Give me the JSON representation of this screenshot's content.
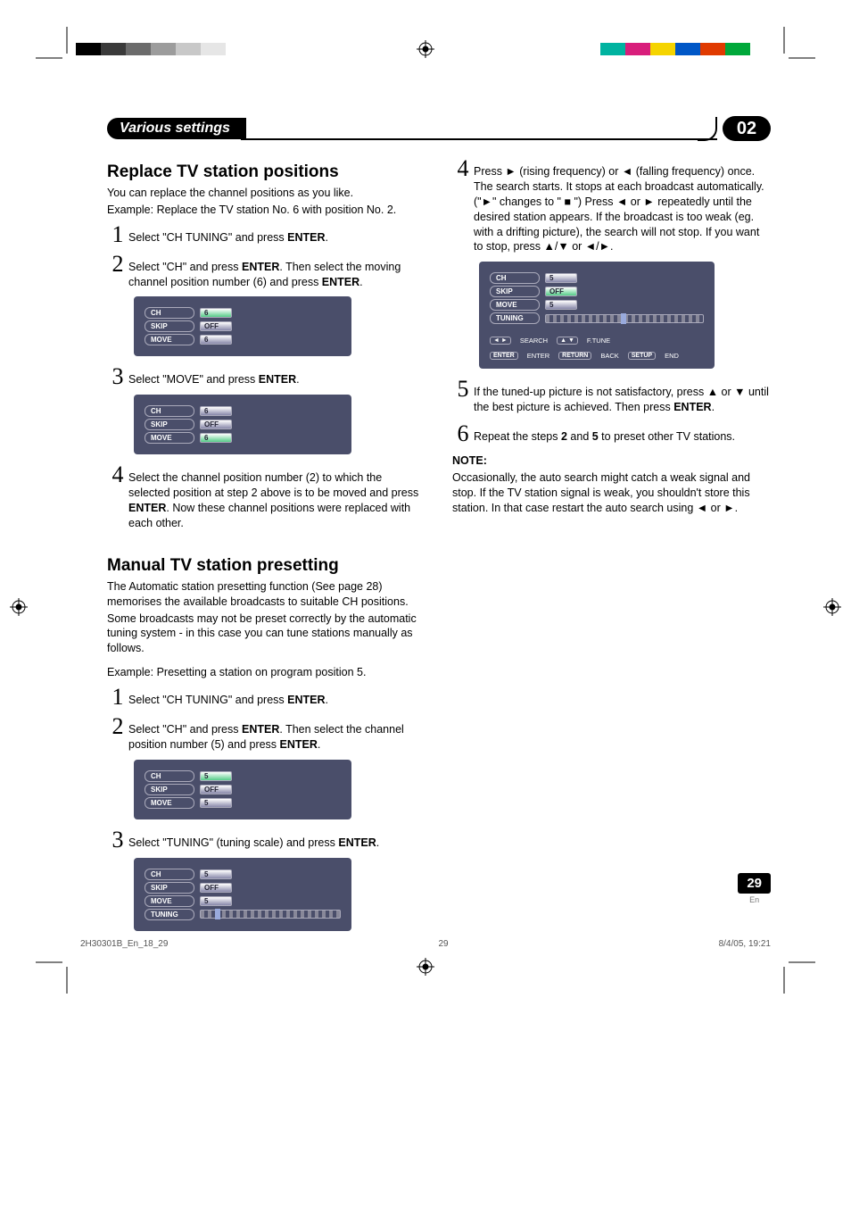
{
  "header": {
    "chapter_title": "Various settings",
    "chapter_number": "02"
  },
  "section1": {
    "title": "Replace TV station positions",
    "intro": "You can replace the channel positions as you like.",
    "example_label": "Example:",
    "example_text": "Replace the TV station No. 6 with position No. 2.",
    "steps": [
      {
        "n": "1",
        "text": "Select \"CH TUNING\" and press ",
        "bold_tail": "ENTER",
        "tail": "."
      },
      {
        "n": "2",
        "text": "Select \"CH\" and press ",
        "bold_tail": "ENTER",
        "tail": ". Then select the moving channel position number (6) and press ",
        "bold_tail2": "ENTER",
        "tail2": "."
      },
      {
        "n": "3",
        "text": "Select \"MOVE\" and press ",
        "bold_tail": "ENTER",
        "tail": "."
      },
      {
        "n": "4",
        "text": "Select the channel position number (2) to which the selected position at step 2 above is to be moved and press ",
        "bold_tail": "ENTER",
        "tail": ". Now these channel positions were replaced with each other."
      }
    ],
    "osd1": {
      "ch": "6",
      "skip": "OFF",
      "move": "6"
    },
    "osd2": {
      "ch": "6",
      "skip": "OFF",
      "move": "6"
    }
  },
  "section2": {
    "title": "Manual TV station presetting",
    "p1": "The Automatic station presetting function (See page 28) memorises the available broadcasts to suitable CH positions.",
    "p2": "Some broadcasts may not be preset correctly by the automatic tuning system - in this case you can tune stations manually as follows.",
    "example": "Example: Presetting a station on program position 5.",
    "steps_left": [
      {
        "n": "1",
        "text": "Select \"CH TUNING\" and press ",
        "bold_tail": "ENTER",
        "tail": "."
      },
      {
        "n": "2",
        "text": "Select \"CH\" and press ",
        "bold_tail": "ENTER",
        "tail": ". Then select the channel position number (5) and press ",
        "bold_tail2": "ENTER",
        "tail2": "."
      },
      {
        "n": "3",
        "text": "Select \"TUNING\" (tuning scale) and press ",
        "bold_tail": "ENTER",
        "tail": "."
      }
    ],
    "osd3": {
      "ch": "5",
      "skip": "OFF",
      "move": "5"
    },
    "osd4": {
      "ch": "5",
      "skip": "OFF",
      "move": "5",
      "tuning": true
    },
    "steps_right": [
      {
        "n": "4",
        "text": "Press ► (rising frequency) or ◄ (falling frequency) once. The search starts. It stops at each broadcast automatically. (\"►\" changes to \" ■ \") Press ◄ or ► repeatedly until the desired station appears.   If the broadcast is too weak (eg. with a drifting picture), the search will not stop. If you want to stop, press ▲/▼ or ◄/►."
      },
      {
        "n": "5",
        "text": "If the tuned-up picture is not satisfactory, press ▲ or ▼ until the best picture is achieved. Then press ",
        "bold_tail": "ENTER",
        "tail": "."
      },
      {
        "n": "6",
        "pre": "Repeat the steps ",
        "bold1": "2",
        "mid": " and ",
        "bold2": "5",
        "post": " to preset other TV stations."
      }
    ],
    "osd5": {
      "ch": "5",
      "skip": "OFF",
      "move": "5",
      "tuning": true,
      "legend": {
        "lr": "◄ ►",
        "search": "SEARCH",
        "ud": "▲ ▼",
        "ftune": "F.TUNE",
        "enter_k": "ENTER",
        "enter_t": "ENTER",
        "return_k": "RETURN",
        "back": "BACK",
        "setup": "SETUP",
        "end": "END"
      }
    },
    "note_title": "NOTE:",
    "note_body": "Occasionally, the auto search might catch a weak signal and stop. If the TV station signal is weak, you shouldn't store this station. In that case restart the auto search using ◄ or ►."
  },
  "osd_labels": {
    "ch": "CH",
    "skip": "SKIP",
    "move": "MOVE",
    "tuning": "TUNING"
  },
  "footer": {
    "file": "2H30301B_En_18_29",
    "page_inner": "29",
    "timestamp": "8/4/05, 19:21",
    "page_number": "29",
    "lang": "En"
  },
  "color_bars": {
    "left": [
      "#000000",
      "#3a3a3a",
      "#6b6b6b",
      "#9c9c9c",
      "#c8c8c8",
      "#e6e6e6",
      "#ffffff"
    ],
    "right": [
      "#00b3a0",
      "#d81e7b",
      "#f5d400",
      "#0057c7",
      "#e03a00",
      "#00a83a",
      "#ffffff"
    ]
  }
}
